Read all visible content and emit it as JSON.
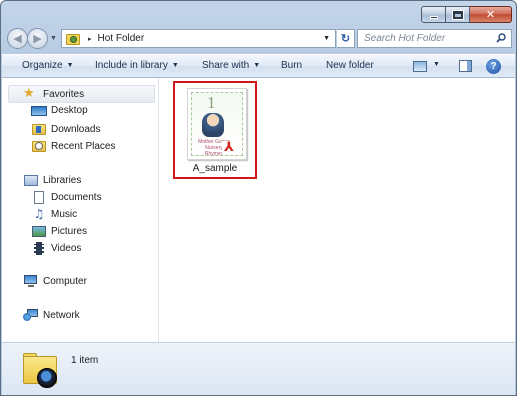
{
  "window": {
    "minimize_icon": "minimize-icon",
    "maximize_icon": "maximize-icon",
    "close_label": "✕"
  },
  "navigation": {
    "back_icon": "back-arrow-icon",
    "forward_icon": "forward-arrow-icon",
    "address": {
      "separator": "▸",
      "path": "Hot Folder"
    },
    "search_placeholder": "Search Hot Folder"
  },
  "toolbar": {
    "organize": "Organize",
    "include_in_library": "Include in library",
    "share_with": "Share with",
    "burn": "Burn",
    "new_folder": "New folder",
    "help": "?"
  },
  "sidebar": {
    "favorites": {
      "label": "Favorites",
      "items": [
        "Desktop",
        "Downloads",
        "Recent Places"
      ]
    },
    "libraries": {
      "label": "Libraries",
      "items": [
        "Documents",
        "Music",
        "Pictures",
        "Videos"
      ]
    },
    "computer": "Computer",
    "network": "Network"
  },
  "files": [
    {
      "name": "A_sample",
      "type": "pdf",
      "thumb_number": "1",
      "thumb_title": "Mother Goose Nursery Rhymes"
    }
  ],
  "status": {
    "count_text": "1 item"
  },
  "colors": {
    "selection_border": "#d2161e",
    "pdf_red": "#d0241a"
  }
}
